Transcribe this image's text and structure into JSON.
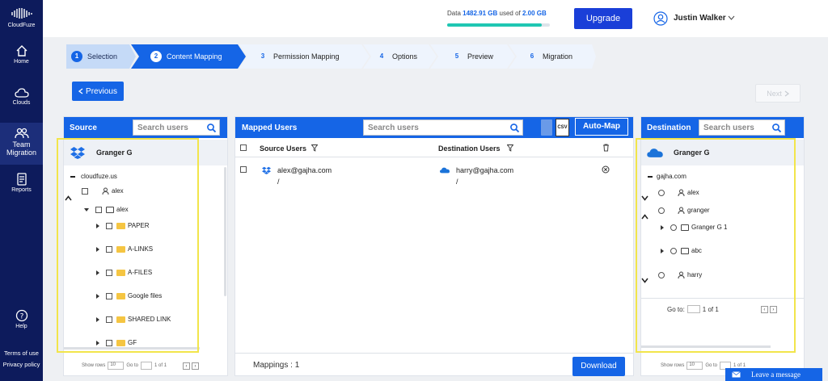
{
  "sidebar": {
    "logo_label": "CloudFuze",
    "items": [
      {
        "label": "Home",
        "icon": "home-icon"
      },
      {
        "label": "Clouds",
        "icon": "cloud-icon"
      },
      {
        "label": "Team",
        "label2": "Migration",
        "icon": "team-icon"
      },
      {
        "label": "Reports",
        "icon": "reports-icon"
      },
      {
        "label": "Help",
        "icon": "help-icon"
      }
    ],
    "terms": "Terms of use",
    "privacy": "Privacy policy"
  },
  "header": {
    "data_prefix": "Data",
    "data_used": "1482.91 GB",
    "used_of": "used of",
    "data_total": "2.00 GB",
    "usage_fraction": 0.92,
    "upgrade": "Upgrade",
    "user_name": "Justin Walker"
  },
  "steps": [
    {
      "num": "1",
      "label": "Selection",
      "state": "done"
    },
    {
      "num": "2",
      "label": "Content Mapping",
      "state": "active"
    },
    {
      "num": "3",
      "label": "Permission Mapping",
      "state": "todo"
    },
    {
      "num": "4",
      "label": "Options",
      "state": "todo"
    },
    {
      "num": "5",
      "label": "Preview",
      "state": "todo"
    },
    {
      "num": "6",
      "label": "Migration",
      "state": "todo"
    }
  ],
  "nav": {
    "previous": "Previous",
    "next": "Next"
  },
  "source": {
    "title": "Source",
    "search_placeholder": "Search users",
    "account": "Granger G",
    "domain": "cloudfuze.us",
    "user": "alex",
    "folder": "alex",
    "children": [
      "PAPER",
      "A-LINKS",
      "A-FILES",
      "Google files",
      "SHARED LINK",
      "GF"
    ],
    "pager": {
      "show_rows": "Show rows",
      "rows": "10",
      "go_to": "Go to",
      "of": "1 of 1"
    }
  },
  "mapped": {
    "title": "Mapped Users",
    "search_placeholder": "Search users",
    "automap": "Auto-Map",
    "csv": "CSV",
    "col_source": "Source Users",
    "col_dest": "Destination Users",
    "rows": [
      {
        "source": "alex@gajha.com",
        "source_path": "/",
        "dest": "harry@gajha.com",
        "dest_path": "/"
      }
    ],
    "mappings": "Mappings : 1",
    "download": "Download"
  },
  "destination": {
    "title": "Destination",
    "search_placeholder": "Search users",
    "account": "Granger G",
    "domain": "gajha.com",
    "users": [
      "alex",
      "granger",
      "harry"
    ],
    "folders": [
      "Granger G 1",
      "abc"
    ],
    "goto_label": "Go to:",
    "goto_of": "1 of 1",
    "pager": {
      "show_rows": "Show rows",
      "rows": "10",
      "go_to": "Go to",
      "of": "1 of 1"
    }
  },
  "chat": {
    "label": "Leave a message"
  },
  "colors": {
    "primary": "#1565e6",
    "sidebar": "#0d1b5c",
    "highlight": "#f2e54b",
    "progress": "#1fc7b3"
  }
}
